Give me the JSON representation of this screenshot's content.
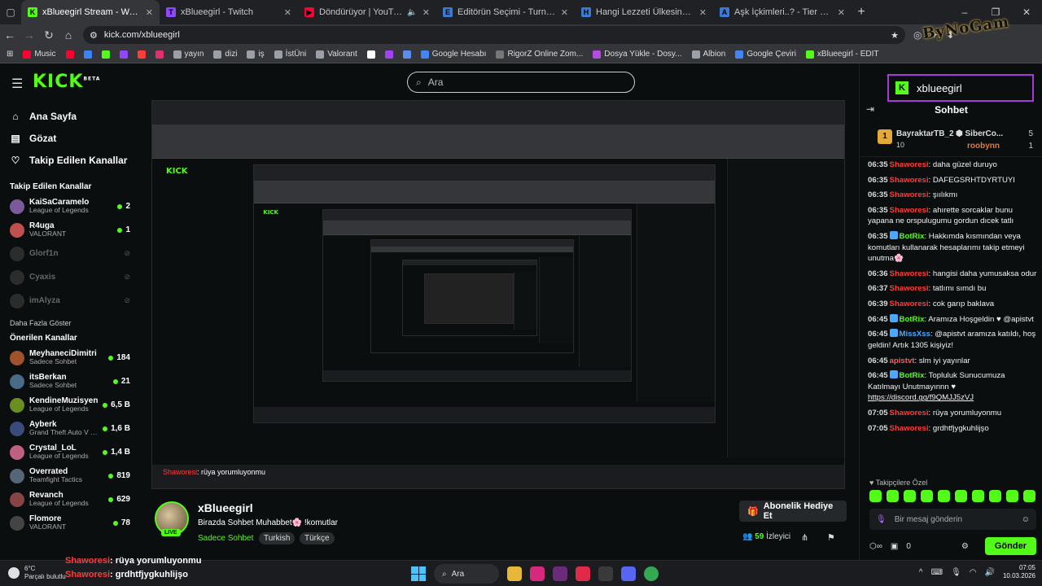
{
  "browser": {
    "tabs": [
      {
        "label": "xBlueegirl Stream - Watch Live",
        "color": "#53fc18",
        "icon": "K",
        "active": true
      },
      {
        "label": "xBlueegirl - Twitch",
        "color": "#9146ff",
        "icon": "T"
      },
      {
        "label": "Döndürüyor | YouTube Mu",
        "color": "#ff0033",
        "icon": "▶",
        "muted": true
      },
      {
        "label": "Editörün Seçimi - Turnuva - Qu",
        "color": "#3a7bd5",
        "icon": "E"
      },
      {
        "label": "Hangi Lezzeti Ülkesinde Denem",
        "color": "#3a7bd5",
        "icon": "H"
      },
      {
        "label": "Aşk İçkimleri..? - Tier List | Kör",
        "color": "#3a7bd5",
        "icon": "A"
      }
    ],
    "url": "kick.com/xblueegirl",
    "bookmarks": [
      {
        "label": "Music",
        "color": "#ff0033"
      },
      {
        "label": "",
        "color": "#ff0033"
      },
      {
        "label": "",
        "color": "#3b82f6"
      },
      {
        "label": "",
        "color": "#53fc18"
      },
      {
        "label": "",
        "color": "#9146ff"
      },
      {
        "label": "",
        "color": "#ff3b3b"
      },
      {
        "label": "",
        "color": "#e1306c"
      },
      {
        "label": "yayın",
        "color": "#9aa0a6"
      },
      {
        "label": "dizi",
        "color": "#9aa0a6"
      },
      {
        "label": "iş",
        "color": "#9aa0a6"
      },
      {
        "label": "İstÜni",
        "color": "#9aa0a6"
      },
      {
        "label": "Valorant",
        "color": "#9aa0a6"
      },
      {
        "label": "",
        "color": "#ffffff"
      },
      {
        "label": "",
        "color": "#a142f4"
      },
      {
        "label": "",
        "color": "#5b8def"
      },
      {
        "label": "Google Hesabı",
        "color": "#4285f4"
      },
      {
        "label": "RigorZ Online Zom...",
        "color": "#777777"
      },
      {
        "label": "Dosya Yükle - Dosy...",
        "color": "#b64bdf"
      },
      {
        "label": "Albion",
        "color": "#9aa0a6"
      },
      {
        "label": "Google Çeviri",
        "color": "#4285f4"
      },
      {
        "label": "xBlueegirl - EDIT",
        "color": "#53fc18"
      }
    ],
    "logo_overlay": "ByNoGam"
  },
  "header": {
    "logo": "KICK",
    "logo_sup": "BETA",
    "search_placeholder": "Ara"
  },
  "sidebar": {
    "nav": [
      {
        "label": "Ana Sayfa",
        "icon": "home-icon"
      },
      {
        "label": "Gözat",
        "icon": "browse-icon"
      },
      {
        "label": "Takip Edilen Kanallar",
        "icon": "heart-icon"
      }
    ],
    "following_title": "Takip Edilen Kanallar",
    "following": [
      {
        "name": "KaiSaCaramelo",
        "game": "League of Legends",
        "viewers": "2",
        "live": true,
        "color": "#7a5a9a"
      },
      {
        "name": "R4uga",
        "game": "VALORANT",
        "viewers": "1",
        "live": true,
        "color": "#c0504d"
      },
      {
        "name": "Glorf1n",
        "game": "",
        "viewers": "",
        "live": false,
        "color": "#666666"
      },
      {
        "name": "Cyaxis",
        "game": "",
        "viewers": "",
        "live": false,
        "color": "#666666"
      },
      {
        "name": "imAlyza",
        "game": "",
        "viewers": "",
        "live": false,
        "color": "#666666"
      }
    ],
    "more": "Daha Fazla Göster",
    "recommended_title": "Önerilen Kanallar",
    "recommended": [
      {
        "name": "MeyhaneciDimitri",
        "game": "Sadece Sohbet",
        "viewers": "184",
        "color": "#a0522d"
      },
      {
        "name": "itsBerkan",
        "game": "Sadece Sohbet",
        "viewers": "21",
        "color": "#4a6a8a"
      },
      {
        "name": "KendineMuzisyen",
        "game": "League of Legends",
        "viewers": "6,5 B",
        "color": "#6b8e23"
      },
      {
        "name": "Ayberk",
        "game": "Grand Theft Auto V (...",
        "viewers": "1,6 B",
        "color": "#3a4a7a"
      },
      {
        "name": "Crystal_LoL",
        "game": "League of Legends",
        "viewers": "1,4 B",
        "color": "#c06080"
      },
      {
        "name": "Overrated",
        "game": "Teamfight Tactics",
        "viewers": "819",
        "color": "#556677"
      },
      {
        "name": "Revanch",
        "game": "League of Legends",
        "viewers": "629",
        "color": "#884444"
      },
      {
        "name": "Flomore",
        "game": "VALORANT",
        "viewers": "78",
        "color": "#444444"
      }
    ]
  },
  "player": {
    "caption_user": "Shaworesi",
    "caption_text": ": rüya yorumluyonmu"
  },
  "stream": {
    "name": "xBlueegirl",
    "title": "Birazda Sohbet Muhabbet🌸 !komutlar",
    "category": "Sadece Sohbet",
    "tags": [
      "Turkish",
      "Türkçe"
    ],
    "live_label": "LIVE",
    "sub_button": "Abonelik Hediye Et",
    "viewers_count": "59",
    "viewers_label": "İzleyici"
  },
  "chat": {
    "banner_name": "xblueegirl",
    "title": "Sohbet",
    "gifters": {
      "first": {
        "rank": "1",
        "name": "BayraktarTB_2",
        "count": "10"
      },
      "second": {
        "name": "SiberCo...",
        "count": "5"
      },
      "third": {
        "name": "roobynn",
        "count": "1"
      }
    },
    "messages": [
      {
        "time": "06:35",
        "user": "Shaworesi",
        "cls": "u-shaw",
        "text": ": daha güzel duruyo",
        "badge": ""
      },
      {
        "time": "06:35",
        "user": "Shaworesi",
        "cls": "u-shaw",
        "text": ": DAFEGSRHTDYRTUYI",
        "badge": ""
      },
      {
        "time": "06:35",
        "user": "Shaworesi",
        "cls": "u-shaw",
        "text": ": şıılıkmı",
        "badge": ""
      },
      {
        "time": "06:35",
        "user": "Shaworesi",
        "cls": "u-shaw",
        "text": ": ahırette sorcaklar bunu yapana ne orspulugumu gordun dıcek tatlı",
        "badge": ""
      },
      {
        "time": "06:35",
        "user": "BotRix",
        "cls": "u-bot",
        "text": ": Hakkımda kısmından veya komutları kullanarak hesaplarımı takip etmeyi unutma🌸",
        "badge": "#4aa8ff"
      },
      {
        "time": "06:36",
        "user": "Shaworesi",
        "cls": "u-shaw",
        "text": ": hangisi daha yumusaksa odur",
        "badge": ""
      },
      {
        "time": "06:37",
        "user": "Shaworesi",
        "cls": "u-shaw",
        "text": ": tatlımı sımdı bu",
        "badge": ""
      },
      {
        "time": "06:39",
        "user": "Shaworesi",
        "cls": "u-shaw",
        "text": ": cok garıp baklava",
        "badge": ""
      },
      {
        "time": "06:45",
        "user": "BotRix",
        "cls": "u-bot",
        "text": ": Aramıza Hoşgeldin ♥ @apistvt",
        "badge": "#4aa8ff"
      },
      {
        "time": "06:45",
        "user": "MissXss",
        "cls": "u-miss",
        "text": ": @apistvt aramıza katıldı, hoş geldin! Artık 1305 kişiyiz!",
        "badge": "#4aa8ff"
      },
      {
        "time": "06:45",
        "user": "apistvt",
        "cls": "u-api",
        "text": ": slm iyi yayınlar",
        "badge": ""
      },
      {
        "time": "06:45",
        "user": "BotRix",
        "cls": "u-bot",
        "text": ": Topluluk Sunucumuza Katılmayı Unutmayınnn ♥",
        "badge": "#4aa8ff",
        "link": "https://discord.gg/f9QMJJ5zVJ"
      },
      {
        "time": "07:05",
        "user": "Shaworesi",
        "cls": "u-shaw",
        "text": ": rüya yorumluyonmu",
        "badge": ""
      },
      {
        "time": "07:05",
        "user": "Shaworesi",
        "cls": "u-shaw",
        "text": ": grdhtfjygkuhlijşo",
        "badge": ""
      }
    ],
    "followers_label": "Takipçilere Özel",
    "input_placeholder": "Bir mesaj gönderin",
    "points": "0",
    "send_label": "Gönder"
  },
  "taskbar": {
    "temp": "6°C",
    "weather": "Parçalı bulutlu",
    "overlay": [
      {
        "user": "Shaworesi",
        "text": ": rüya yorumluyonmu"
      },
      {
        "user": "Shaworesi",
        "text": ": grdhtfjygkuhlijşo"
      }
    ],
    "search": "Ara",
    "time": "07:05",
    "date": "10.03.2026"
  }
}
